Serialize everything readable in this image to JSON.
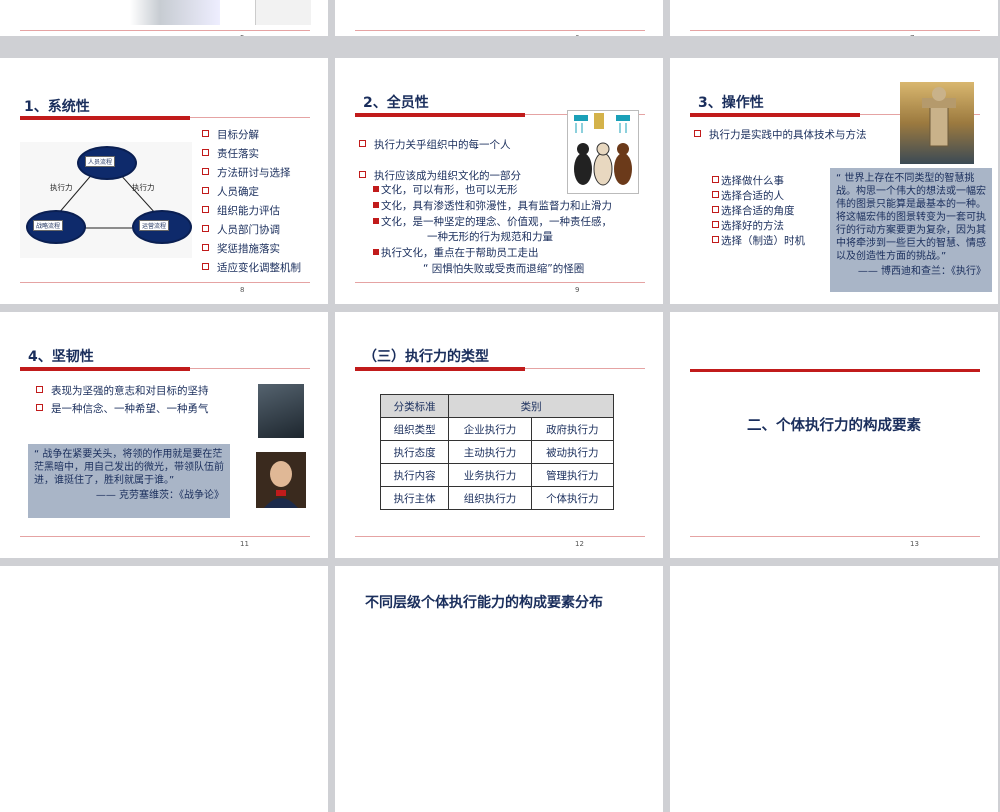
{
  "slides_top": [
    {
      "num": "5"
    },
    {
      "num": "6"
    },
    {
      "num": "7"
    }
  ],
  "slide8": {
    "num": "8",
    "title": "1、系统性",
    "diagram": {
      "node_top": "人员流程",
      "node_left": "战略流程",
      "node_right": "运营流程",
      "label_left": "执行力",
      "label_right": "执行力"
    },
    "items": [
      "目标分解",
      "责任落实",
      "方法研讨与选择",
      "人员确定",
      "组织能力评估",
      "人员部门协调",
      "奖惩措施落实",
      "适应变化调整机制"
    ]
  },
  "slide9": {
    "num": "9",
    "title": "2、全员性",
    "b1": "执行力关乎组织中的每一个人",
    "b2": "执行应该成为组织文化的一部分",
    "s1": "文化，可以有形，也可以无形",
    "s2": "文化，具有渗透性和弥漫性，具有监督力和止滑力",
    "s3a": "文化，是一种坚定的理念、价值观，一种责任感，",
    "s3b": "一种无形的行为规范和力量",
    "s4": "执行文化，重点在于帮助员工走出",
    "s4b": "“ 因惧怕失败或受责而退缩”的怪圈"
  },
  "slide10": {
    "num": "",
    "title": "3、操作性",
    "b1": "执行力是实践中的具体技术与方法",
    "items": [
      "选择做什么事",
      "选择合适的人",
      "选择合适的角度",
      "选择好的方法",
      "选择（制造）时机"
    ],
    "quote": "“ 世界上存在不同类型的智慧挑战。构思一个伟大的想法或一幅宏伟的图景只能算是最基本的一种。将这幅宏伟的图景转变为一套可执行的行动方案要更为复杂，因为其中将牵涉到一些巨大的智慧、情感以及创造性方面的挑战。”",
    "source": "—— 博西迪和查兰：《执行》"
  },
  "slide11": {
    "num": "11",
    "title": "4、坚韧性",
    "b1": "表现为坚强的意志和对目标的坚持",
    "b2": "是一种信念、一种希望、一种勇气",
    "quote": "“ 战争在紧要关头，将领的作用就是要在茫茫黑暗中，用自己发出的微光，带领队伍前进，谁挺住了，胜利就属于谁。”",
    "source": "—— 克劳塞维茨：《战争论》"
  },
  "slide12": {
    "num": "12",
    "title": "（三）执行力的类型",
    "header": [
      "分类标准",
      "类别"
    ],
    "rows": [
      [
        "组织类型",
        "企业执行力",
        "政府执行力"
      ],
      [
        "执行态度",
        "主动执行力",
        "被动执行力"
      ],
      [
        "执行内容",
        "业务执行力",
        "管理执行力"
      ],
      [
        "执行主体",
        "组织执行力",
        "个体执行力"
      ]
    ]
  },
  "slide13": {
    "num": "13",
    "title": "二、个体执行力的构成要素"
  },
  "slide_bottom_mid": {
    "title": "不同层级个体执行能力的构成要素分布"
  },
  "colors": {
    "accent": "#c11b1b",
    "navy": "#1a2e5c",
    "quote_bg": "#a9b5c7"
  }
}
